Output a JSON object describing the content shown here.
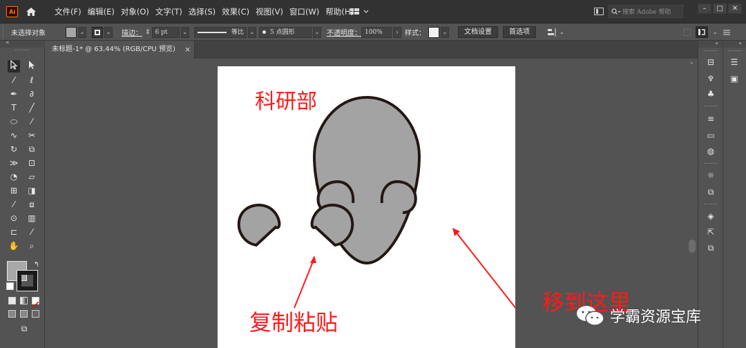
{
  "app": {
    "logo_text": "Ai"
  },
  "menu": {
    "items": [
      "文件(F)",
      "编辑(E)",
      "对象(O)",
      "文字(T)",
      "选择(S)",
      "效果(C)",
      "视图(V)",
      "窗口(W)",
      "帮助(H)"
    ]
  },
  "search": {
    "placeholder": "搜索 Adobe 帮助"
  },
  "window_controls": {
    "minimize": "–",
    "maximize": "□",
    "close": "✕"
  },
  "controlbar": {
    "selection_status": "未选择对象",
    "stroke_label": "描边：",
    "stroke_value": "6 pt",
    "stroke_profile": "等比",
    "brush_label": "5 点圆形",
    "opacity_label": "不透明度：",
    "opacity_value": "100%",
    "style_label": "样式：",
    "doc_setup_button": "文档设置",
    "preferences_button": "首选项",
    "colors": {
      "fill": "#a6a6a6",
      "stroke": "#1a1a1a"
    }
  },
  "document_tab": {
    "title": "未标题-1* @ 63.44% (RGB/CPU 预览)",
    "close": "×"
  },
  "artwork": {
    "colors": {
      "shape_fill": "#a3a3a3",
      "shape_stroke": "#231815",
      "annotation": "#ff1a1a"
    },
    "labels": {
      "department": "科研部",
      "copy_paste": "复制粘贴",
      "move_here": "移到这里"
    }
  },
  "watermark": {
    "text": "学霸资源宝库",
    "icon": "wechat-icon"
  }
}
